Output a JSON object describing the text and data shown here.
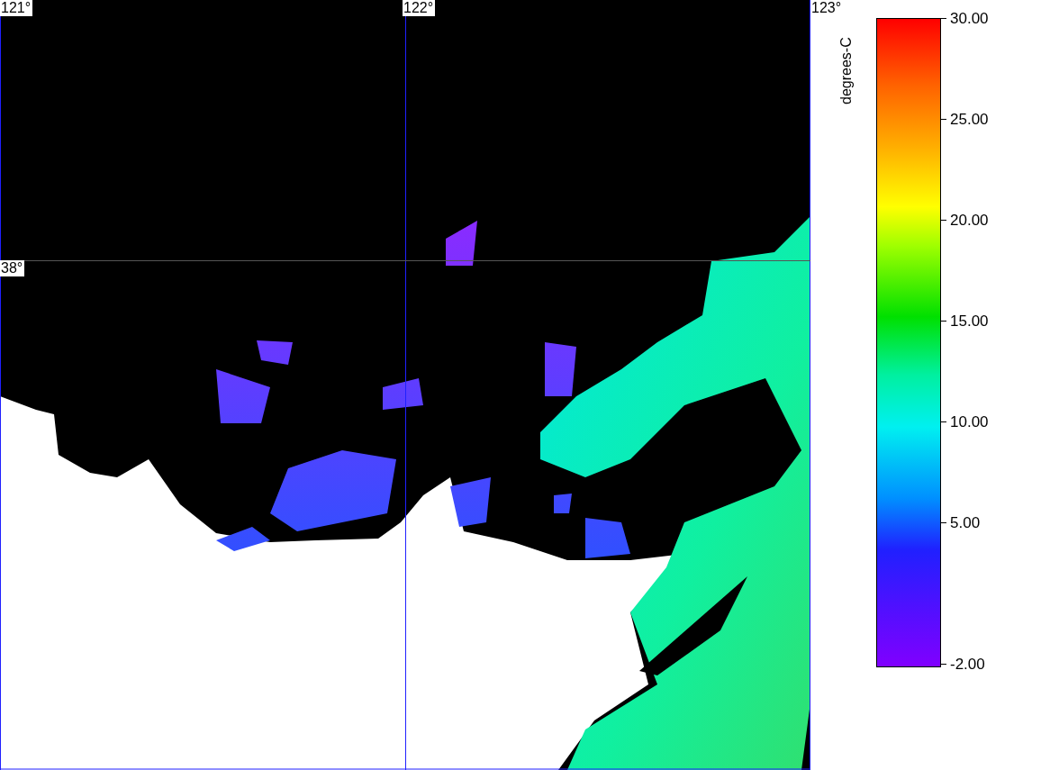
{
  "map": {
    "graticule_labels": [
      {
        "text": "121°",
        "kind": "lon"
      },
      {
        "text": "122°",
        "kind": "lon"
      },
      {
        "text": "123°",
        "kind": "lon"
      },
      {
        "text": "38°",
        "kind": "lat"
      }
    ]
  },
  "colorbar": {
    "title": "degrees-C",
    "ticks": [
      "30.00",
      "25.00",
      "20.00",
      "15.00",
      "10.00",
      "5.00",
      "-2.00"
    ]
  }
}
